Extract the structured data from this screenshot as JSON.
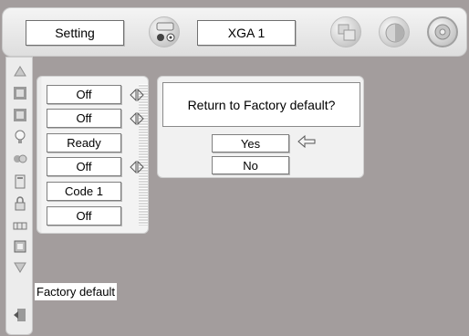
{
  "topbar": {
    "menu_title": "Setting",
    "input_source": "XGA 1",
    "icons": [
      "computer-input-icon",
      "pc-adjust-icon",
      "image-adjust-icon",
      "setting-icon"
    ]
  },
  "sidebar": {
    "icons": [
      "scroll-up-icon",
      "keystone-icon",
      "ceiling-icon",
      "lamp-icon",
      "fan-icon",
      "remote-control-icon",
      "lock-icon",
      "filter-icon",
      "factory-default-icon",
      "scroll-down-icon",
      "exit-icon"
    ]
  },
  "settings_values": [
    {
      "value": "Off",
      "has_arrows": true
    },
    {
      "value": "Off",
      "has_arrows": true
    },
    {
      "value": "Ready",
      "has_arrows": false
    },
    {
      "value": "Off",
      "has_arrows": true
    },
    {
      "value": "Code 1",
      "has_arrows": false
    },
    {
      "value": "Off",
      "has_arrows": false
    }
  ],
  "dialog": {
    "prompt": "Return to Factory default?",
    "yes_label": "Yes",
    "no_label": "No",
    "selected": "Yes"
  },
  "tooltip": "Factory default",
  "colors": {
    "background": "#a39d9d",
    "panel": "#f1f1f1"
  }
}
